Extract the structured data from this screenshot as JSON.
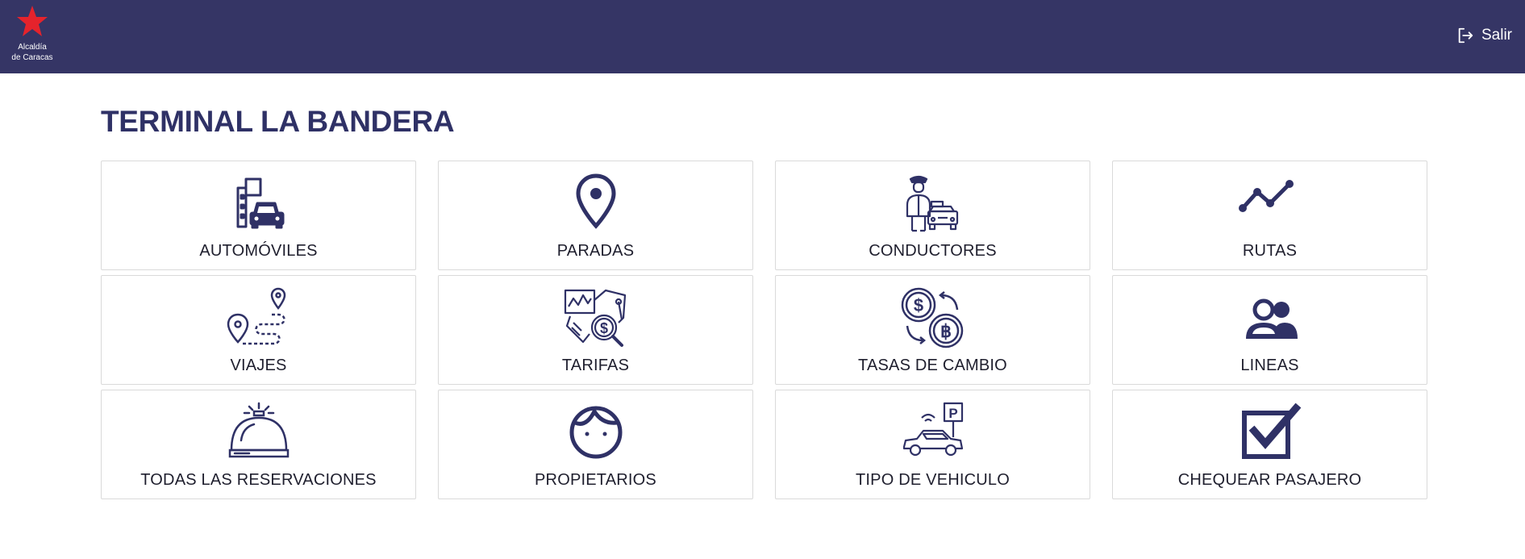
{
  "header": {
    "logo_line1": "Alcaldía",
    "logo_line2": "de Caracas",
    "logout_label": "Salir",
    "bar_color": "#353565",
    "star_color": "#e5232c"
  },
  "page": {
    "title": "TERMINAL LA BANDERA"
  },
  "menu": [
    {
      "label": "AUTOMÓVILES",
      "icon": "city-car-icon"
    },
    {
      "label": "PARADAS",
      "icon": "map-pin-icon"
    },
    {
      "label": "CONDUCTORES",
      "icon": "driver-taxi-icon"
    },
    {
      "label": "RUTAS",
      "icon": "route-line-icon"
    },
    {
      "label": "VIAJES",
      "icon": "trip-path-icon"
    },
    {
      "label": "TARIFAS",
      "icon": "fare-analysis-icon"
    },
    {
      "label": "TASAS DE CAMBIO",
      "icon": "currency-exchange-icon"
    },
    {
      "label": "LINEAS",
      "icon": "users-group-icon"
    },
    {
      "label": "TODAS LAS RESERVACIONES",
      "icon": "reception-bell-icon"
    },
    {
      "label": "PROPIETARIOS",
      "icon": "person-face-icon"
    },
    {
      "label": "TIPO DE VEHICULO",
      "icon": "connected-car-parking-icon"
    },
    {
      "label": "CHEQUEAR PASAJERO",
      "icon": "checkbox-check-icon"
    }
  ]
}
